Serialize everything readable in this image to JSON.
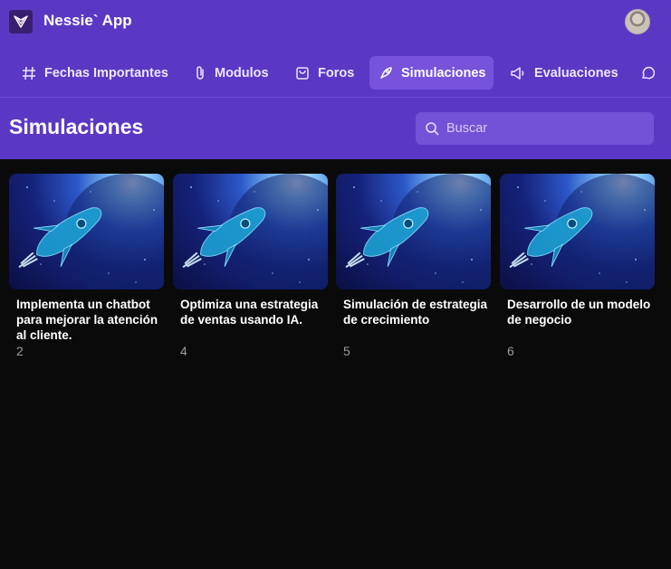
{
  "app": {
    "name": "Nessie` App"
  },
  "nav": {
    "items": [
      {
        "label": "Fechas Importantes",
        "icon": "hash-icon"
      },
      {
        "label": "Modulos",
        "icon": "paperclip-icon"
      },
      {
        "label": "Foros",
        "icon": "shopping-bag-icon"
      },
      {
        "label": "Simulaciones",
        "icon": "rocket-icon",
        "active": true
      },
      {
        "label": "Evaluaciones",
        "icon": "megaphone-icon"
      },
      {
        "label": "",
        "icon": "chat-bubble-icon"
      }
    ]
  },
  "page": {
    "title": "Simulaciones"
  },
  "search": {
    "placeholder": "Buscar",
    "value": ""
  },
  "cards": [
    {
      "title": "Implementa un chatbot para mejorar la atención al cliente.",
      "count": "2"
    },
    {
      "title": "Optimiza una estrategia de ventas usando IA.",
      "count": "4"
    },
    {
      "title": "Simulación de estrategia de crecimiento",
      "count": "5"
    },
    {
      "title": "Desarrollo de un modelo de negocio",
      "count": "6"
    }
  ],
  "colors": {
    "header": "#5b38c4",
    "active_tab": "#7653da",
    "search_bg": "#7252d6",
    "background": "#0a0a0a",
    "count_text": "#9b9b9b"
  }
}
